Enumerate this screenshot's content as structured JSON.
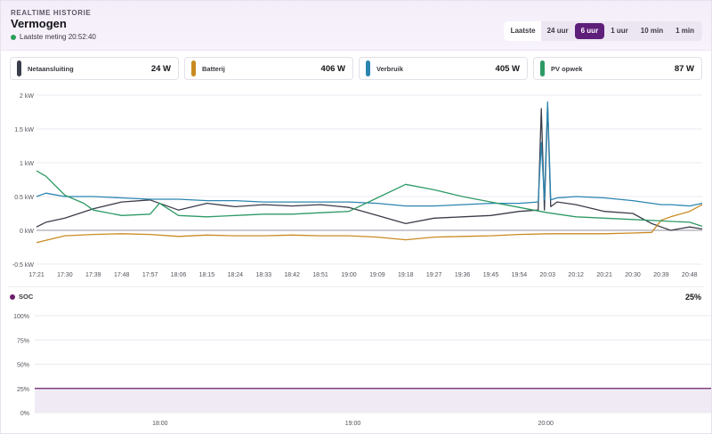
{
  "header": {
    "subtitle": "REALTIME HISTORIE",
    "title": "Vermogen",
    "last_measurement": "Laatste meting 20:52:40",
    "status_color": "#2d9e5b"
  },
  "range": {
    "label": "Laatste",
    "options": [
      "24 uur",
      "6 uur",
      "1 uur",
      "10 min",
      "1 min"
    ],
    "active": "6 uur"
  },
  "cards": [
    {
      "name": "Netaansluiting",
      "value": "24 W",
      "color": "#3a3d4a"
    },
    {
      "name": "Batterij",
      "value": "406 W",
      "color": "#c98a22"
    },
    {
      "name": "Verbruik",
      "value": "405 W",
      "color": "#2b85b0"
    },
    {
      "name": "PV opwek",
      "value": "87 W",
      "color": "#2e9a66"
    }
  ],
  "chart_data": [
    {
      "type": "line",
      "title": "",
      "xlabel": "",
      "ylabel": "",
      "y_ticks": [
        "2 kW",
        "1.5 kW",
        "1 kW",
        "0.5 kW",
        "0 kW",
        "-0.5 kW"
      ],
      "ylim": [
        -0.5,
        2
      ],
      "x_ticks": [
        "17:21",
        "17:30",
        "17:39",
        "17:48",
        "17:57",
        "18:06",
        "18:15",
        "18:24",
        "18:33",
        "18:42",
        "18:51",
        "19:00",
        "19:09",
        "19:18",
        "19:27",
        "19:36",
        "19:45",
        "19:54",
        "20:03",
        "20:12",
        "20:21",
        "20:30",
        "20:39",
        "20:48"
      ],
      "grid": true,
      "series": [
        {
          "name": "Netaansluiting",
          "color": "#3a3d4a",
          "x": [
            "17:21",
            "17:24",
            "17:30",
            "17:39",
            "17:48",
            "17:57",
            "18:06",
            "18:15",
            "18:24",
            "18:33",
            "18:42",
            "18:51",
            "19:00",
            "19:09",
            "19:18",
            "19:27",
            "19:36",
            "19:45",
            "19:54",
            "20:00",
            "20:01",
            "20:02",
            "20:03",
            "20:04",
            "20:06",
            "20:12",
            "20:21",
            "20:30",
            "20:36",
            "20:39",
            "20:42",
            "20:48",
            "20:52"
          ],
          "y": [
            0.05,
            0.12,
            0.18,
            0.32,
            0.42,
            0.45,
            0.3,
            0.4,
            0.35,
            0.38,
            0.36,
            0.38,
            0.34,
            0.22,
            0.1,
            0.18,
            0.2,
            0.22,
            0.28,
            0.3,
            1.8,
            0.3,
            1.85,
            0.35,
            0.42,
            0.38,
            0.28,
            0.25,
            0.1,
            0.05,
            0.0,
            0.05,
            0.02
          ]
        },
        {
          "name": "Batterij",
          "color": "#c98a22",
          "x": [
            "17:21",
            "17:30",
            "17:39",
            "17:48",
            "17:57",
            "18:06",
            "18:15",
            "18:24",
            "18:33",
            "18:42",
            "18:51",
            "19:00",
            "19:09",
            "19:18",
            "19:27",
            "19:36",
            "19:45",
            "19:54",
            "20:03",
            "20:12",
            "20:21",
            "20:30",
            "20:36",
            "20:39",
            "20:42",
            "20:48",
            "20:52"
          ],
          "y": [
            -0.18,
            -0.08,
            -0.06,
            -0.05,
            -0.06,
            -0.09,
            -0.07,
            -0.08,
            -0.08,
            -0.07,
            -0.08,
            -0.08,
            -0.1,
            -0.14,
            -0.1,
            -0.09,
            -0.08,
            -0.06,
            -0.05,
            -0.05,
            -0.05,
            -0.04,
            -0.03,
            0.15,
            0.2,
            0.28,
            0.38
          ]
        },
        {
          "name": "Verbruik",
          "color": "#2b85b0",
          "x": [
            "17:21",
            "17:24",
            "17:30",
            "17:39",
            "17:48",
            "17:57",
            "18:06",
            "18:15",
            "18:24",
            "18:33",
            "18:42",
            "18:51",
            "19:00",
            "19:09",
            "19:18",
            "19:27",
            "19:36",
            "19:45",
            "19:54",
            "20:00",
            "20:01",
            "20:02",
            "20:03",
            "20:04",
            "20:06",
            "20:12",
            "20:21",
            "20:30",
            "20:36",
            "20:39",
            "20:42",
            "20:48",
            "20:52"
          ],
          "y": [
            0.5,
            0.55,
            0.5,
            0.5,
            0.48,
            0.46,
            0.46,
            0.44,
            0.44,
            0.42,
            0.42,
            0.42,
            0.42,
            0.4,
            0.36,
            0.36,
            0.38,
            0.4,
            0.4,
            0.42,
            1.3,
            0.45,
            1.9,
            0.45,
            0.48,
            0.5,
            0.48,
            0.44,
            0.4,
            0.38,
            0.38,
            0.36,
            0.4
          ]
        },
        {
          "name": "PV opwek",
          "color": "#2e9a66",
          "x": [
            "17:21",
            "17:24",
            "17:30",
            "17:36",
            "17:39",
            "17:48",
            "17:57",
            "18:00",
            "18:06",
            "18:15",
            "18:24",
            "18:33",
            "18:42",
            "18:51",
            "19:00",
            "19:09",
            "19:18",
            "19:27",
            "19:36",
            "19:45",
            "19:54",
            "20:03",
            "20:12",
            "20:21",
            "20:30",
            "20:39",
            "20:48",
            "20:52"
          ],
          "y": [
            0.88,
            0.8,
            0.52,
            0.4,
            0.3,
            0.22,
            0.24,
            0.4,
            0.22,
            0.2,
            0.22,
            0.24,
            0.24,
            0.26,
            0.28,
            0.48,
            0.68,
            0.6,
            0.5,
            0.42,
            0.34,
            0.26,
            0.2,
            0.18,
            0.16,
            0.14,
            0.12,
            0.06
          ]
        }
      ]
    },
    {
      "type": "area",
      "title": "SOC",
      "value_label": "25%",
      "y_ticks": [
        "100%",
        "75%",
        "50%",
        "25%",
        "0%"
      ],
      "ylim": [
        0,
        100
      ],
      "x_ticks": [
        "18:00",
        "19:00",
        "20:00"
      ],
      "grid": true,
      "series": [
        {
          "name": "SOC",
          "color": "#6b1f69",
          "x": [
            "17:21",
            "20:52"
          ],
          "y": [
            25,
            25
          ]
        }
      ]
    }
  ]
}
